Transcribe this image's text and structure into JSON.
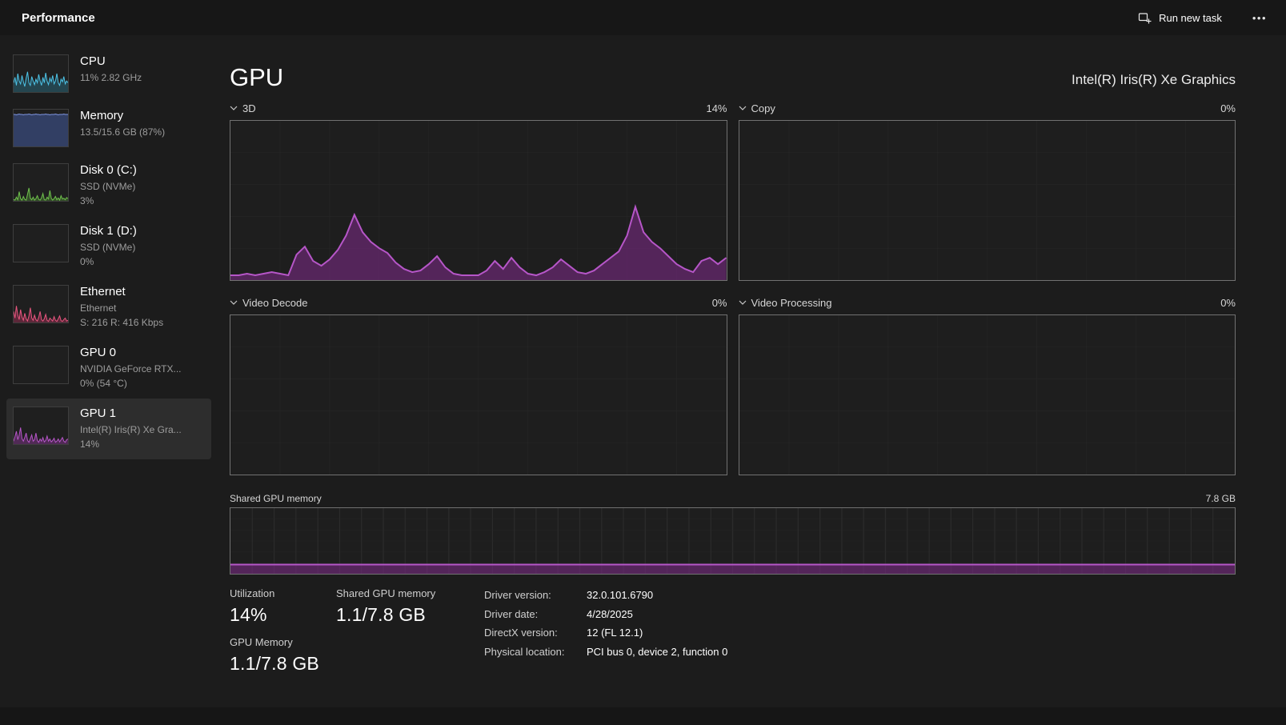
{
  "header": {
    "title": "Performance",
    "run_new_task_label": "Run new task",
    "more_icon": "•••"
  },
  "sidebar": {
    "items": [
      {
        "id": "cpu",
        "title": "CPU",
        "lines": [
          "11%  2.82 GHz"
        ],
        "selected": false
      },
      {
        "id": "memory",
        "title": "Memory",
        "lines": [
          "13.5/15.6 GB (87%)"
        ],
        "selected": false
      },
      {
        "id": "disk0",
        "title": "Disk 0 (C:)",
        "lines": [
          "SSD (NVMe)",
          "3%"
        ],
        "selected": false
      },
      {
        "id": "disk1",
        "title": "Disk 1 (D:)",
        "lines": [
          "SSD (NVMe)",
          "0%"
        ],
        "selected": false
      },
      {
        "id": "ethernet",
        "title": "Ethernet",
        "lines": [
          "Ethernet",
          "S: 216 R: 416 Kbps"
        ],
        "selected": false
      },
      {
        "id": "gpu0",
        "title": "GPU 0",
        "lines": [
          "NVIDIA GeForce RTX...",
          "0%  (54 °C)"
        ],
        "selected": false
      },
      {
        "id": "gpu1",
        "title": "GPU 1",
        "lines": [
          "Intel(R) Iris(R) Xe Gra...",
          "14%"
        ],
        "selected": true
      }
    ]
  },
  "main": {
    "title": "GPU",
    "device_name": "Intel(R) Iris(R) Xe Graphics",
    "engine_charts": [
      {
        "label": "3D",
        "value": "14%"
      },
      {
        "label": "Copy",
        "value": "0%"
      },
      {
        "label": "Video Decode",
        "value": "0%"
      },
      {
        "label": "Video Processing",
        "value": "0%"
      }
    ],
    "shared_chart": {
      "label": "Shared GPU memory",
      "max_label": "7.8 GB"
    },
    "stats": {
      "utilization": {
        "label": "Utilization",
        "value": "14%"
      },
      "gpu_memory": {
        "label": "GPU Memory",
        "value": "1.1/7.8 GB"
      },
      "shared_memory": {
        "label": "Shared GPU memory",
        "value": "1.1/7.8 GB"
      },
      "details": [
        {
          "label": "Driver version:",
          "value": "32.0.101.6790"
        },
        {
          "label": "Driver date:",
          "value": "4/28/2025"
        },
        {
          "label": "DirectX version:",
          "value": "12 (FL 12.1)"
        },
        {
          "label": "Physical location:",
          "value": "PCI bus 0, device 2, function 0"
        }
      ]
    }
  },
  "chart_data": {
    "engine_charts": [
      {
        "name": "3D",
        "type": "area",
        "unit": "%",
        "ylim": [
          0,
          100
        ],
        "current": 14,
        "values": [
          3,
          3,
          4,
          3,
          4,
          5,
          4,
          3,
          16,
          21,
          12,
          9,
          13,
          19,
          28,
          41,
          30,
          24,
          20,
          17,
          11,
          7,
          5,
          6,
          10,
          15,
          8,
          4,
          3,
          3,
          3,
          6,
          12,
          7,
          14,
          8,
          4,
          3,
          5,
          8,
          13,
          9,
          5,
          4,
          6,
          10,
          14,
          18,
          28,
          46,
          30,
          24,
          20,
          15,
          10,
          7,
          5,
          12,
          14,
          10,
          14
        ]
      },
      {
        "name": "Copy",
        "type": "area",
        "unit": "%",
        "ylim": [
          0,
          100
        ],
        "current": 0,
        "values": []
      },
      {
        "name": "Video Decode",
        "type": "area",
        "unit": "%",
        "ylim": [
          0,
          100
        ],
        "current": 0,
        "values": []
      },
      {
        "name": "Video Processing",
        "type": "area",
        "unit": "%",
        "ylim": [
          0,
          100
        ],
        "current": 0,
        "values": []
      }
    ],
    "shared_memory": {
      "name": "Shared GPU memory",
      "type": "area",
      "total_gb": 7.8,
      "current_gb": 1.1,
      "unit": "% of total",
      "values": [
        14,
        14,
        14,
        14,
        14,
        14,
        14,
        14,
        14,
        14,
        14,
        14,
        14,
        14,
        14,
        14,
        14,
        14,
        14,
        14,
        14,
        14,
        14,
        14,
        14,
        14,
        14,
        14,
        14,
        14,
        14
      ]
    },
    "sidebar_sparklines": {
      "cpu": [
        25,
        40,
        18,
        50,
        30,
        22,
        45,
        28,
        15,
        38,
        55,
        25,
        18,
        42,
        30,
        20,
        35,
        25,
        48,
        30,
        18,
        40,
        25,
        52,
        30,
        20,
        38,
        28,
        45,
        22,
        30,
        50,
        25,
        18,
        35,
        28,
        42,
        22,
        30,
        25
      ],
      "memory": [
        87,
        87,
        86,
        87,
        88,
        87,
        87,
        86,
        87,
        87,
        87,
        88,
        87,
        86,
        87,
        87,
        88,
        87,
        87,
        86,
        87,
        87,
        87,
        88,
        87,
        87,
        86,
        87,
        87,
        87,
        88,
        87,
        86,
        87,
        87,
        87,
        88,
        87,
        87,
        87
      ],
      "disk0": [
        4,
        2,
        10,
        3,
        25,
        6,
        2,
        12,
        4,
        2,
        18,
        35,
        7,
        3,
        10,
        2,
        6,
        14,
        4,
        2,
        8,
        20,
        3,
        2,
        10,
        5,
        28,
        7,
        2,
        6,
        12,
        3,
        8,
        2,
        14,
        5,
        7,
        3,
        9,
        6
      ],
      "disk1": [],
      "ethernet": [
        30,
        12,
        45,
        20,
        8,
        35,
        15,
        6,
        25,
        10,
        4,
        18,
        40,
        12,
        6,
        20,
        8,
        4,
        14,
        30,
        8,
        4,
        10,
        22,
        6,
        3,
        12,
        8,
        4,
        16,
        6,
        3,
        10,
        18,
        5,
        3,
        8,
        12,
        4,
        6
      ],
      "gpu0": [],
      "gpu1": [
        8,
        20,
        35,
        12,
        25,
        45,
        15,
        8,
        18,
        30,
        10,
        5,
        15,
        25,
        8,
        12,
        30,
        10,
        5,
        14,
        8,
        18,
        6,
        10,
        22,
        8,
        14,
        6,
        10,
        16,
        5,
        8,
        14,
        6,
        12,
        18,
        8,
        5,
        12,
        14
      ]
    },
    "colors": {
      "cpu": {
        "line": "#4dc4e8",
        "fill": "rgba(45,140,170,0.35)"
      },
      "memory": {
        "line": "#7f95e0",
        "fill": "rgba(70,95,170,0.50)"
      },
      "disk0": {
        "line": "#6fc24c",
        "fill": "rgba(85,160,55,0.35)"
      },
      "disk1": {
        "line": "#6fc24c",
        "fill": "rgba(85,160,55,0.35)"
      },
      "ethernet": {
        "line": "#e8567f",
        "fill": "rgba(205,55,105,0.35)"
      },
      "gpu0": {
        "line": "#b656c8",
        "fill": "rgba(140,55,150,0.45)"
      },
      "gpu1": {
        "line": "#b656c8",
        "fill": "rgba(140,55,150,0.45)"
      },
      "gpu_engine": {
        "line": "#b656c8",
        "fill": "rgba(120,42,130,0.60)"
      }
    }
  }
}
